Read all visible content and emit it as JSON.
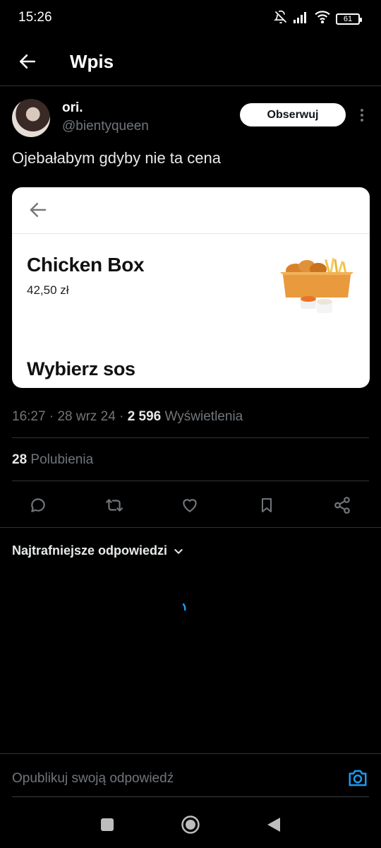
{
  "status_bar": {
    "time": "15:26",
    "battery": "61"
  },
  "header": {
    "title": "Wpis"
  },
  "author": {
    "name": "ori.",
    "handle": "@bientyqueen",
    "follow_label": "Obserwuj"
  },
  "post": {
    "text": "Ojebałabym gdyby nie ta cena"
  },
  "media_card": {
    "product_name": "Chicken Box",
    "price": "42,50 zł",
    "section_title": "Wybierz sos"
  },
  "meta": {
    "time": "16:27",
    "sep1": " · ",
    "date": "28 wrz 24",
    "sep2": " · ",
    "views_count": "2 596",
    "views_label": " Wyświetlenia"
  },
  "likes": {
    "count": "28",
    "label": " Polubienia"
  },
  "replies": {
    "sort_label": "Najtrafniejsze odpowiedzi"
  },
  "reply_composer": {
    "placeholder": "Opublikuj swoją odpowiedź"
  },
  "colors": {
    "accent": "#1d9bf0",
    "background": "#000000",
    "muted_text": "#71767b",
    "divider": "#2f3336"
  },
  "icons": [
    "back-arrow-icon",
    "more-vertical-icon",
    "reply-icon",
    "retweet-icon",
    "like-icon",
    "bookmark-icon",
    "share-icon",
    "chevron-down-icon",
    "camera-icon",
    "muted-bell-icon",
    "signal-icon",
    "wifi-icon",
    "battery-icon",
    "nav-square-icon",
    "nav-home-icon",
    "nav-back-icon"
  ]
}
